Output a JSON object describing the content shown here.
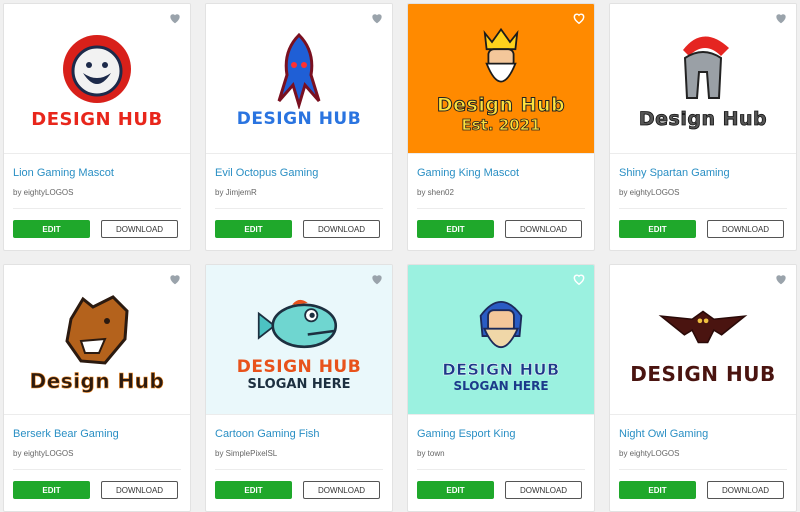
{
  "cards": [
    {
      "title": "Lion Gaming Mascot",
      "author": "by eightyLOGOS",
      "edit": "EDIT",
      "download": "DOWNLOAD",
      "wordmark": "DESIGN HUB",
      "slogan": "",
      "bg": "#ffffff",
      "wm_color": "#e8261b",
      "icon": "lion-icon"
    },
    {
      "title": "Evil Octopus Gaming",
      "author": "by JimjemR",
      "edit": "EDIT",
      "download": "DOWNLOAD",
      "wordmark": "DESIGN HUB",
      "slogan": "",
      "bg": "#ffffff",
      "wm_color": "#2a74e0",
      "icon": "octopus-icon"
    },
    {
      "title": "Gaming King Mascot",
      "author": "by shen02",
      "edit": "EDIT",
      "download": "DOWNLOAD",
      "wordmark": "Design Hub",
      "slogan": "Est. 2021",
      "bg": "#ff8a00",
      "wm_color": "#ffe23d",
      "icon": "king-icon"
    },
    {
      "title": "Shiny Spartan Gaming",
      "author": "by eightyLOGOS",
      "edit": "EDIT",
      "download": "DOWNLOAD",
      "wordmark": "Design Hub",
      "slogan": "",
      "bg": "#ffffff",
      "wm_color": "#444444",
      "icon": "spartan-helmet-icon"
    },
    {
      "title": "Berserk Bear Gaming",
      "author": "by eightyLOGOS",
      "edit": "EDIT",
      "download": "DOWNLOAD",
      "wordmark": "Design Hub",
      "slogan": "",
      "bg": "#ffffff",
      "wm_color": "#2b1a10",
      "icon": "bear-icon"
    },
    {
      "title": "Cartoon Gaming Fish",
      "author": "by SimplePixelSL",
      "edit": "EDIT",
      "download": "DOWNLOAD",
      "wordmark": "DESIGN HUB",
      "slogan": "SLOGAN HERE",
      "bg": "#eaf8fb",
      "wm_color": "#e8521b",
      "icon": "fish-icon"
    },
    {
      "title": "Gaming Esport King",
      "author": "by town",
      "edit": "EDIT",
      "download": "DOWNLOAD",
      "wordmark": "DESIGN HUB",
      "slogan": "SLOGAN HERE",
      "bg": "#9bf1e0",
      "wm_color": "#1c3a8a",
      "icon": "bearded-king-icon"
    },
    {
      "title": "Night Owl Gaming",
      "author": "by eightyLOGOS",
      "edit": "EDIT",
      "download": "DOWNLOAD",
      "wordmark": "DESIGN HUB",
      "slogan": "",
      "bg": "#ffffff",
      "wm_color": "#4a1410",
      "icon": "owl-icon"
    }
  ],
  "heart_icon": "heart-icon"
}
